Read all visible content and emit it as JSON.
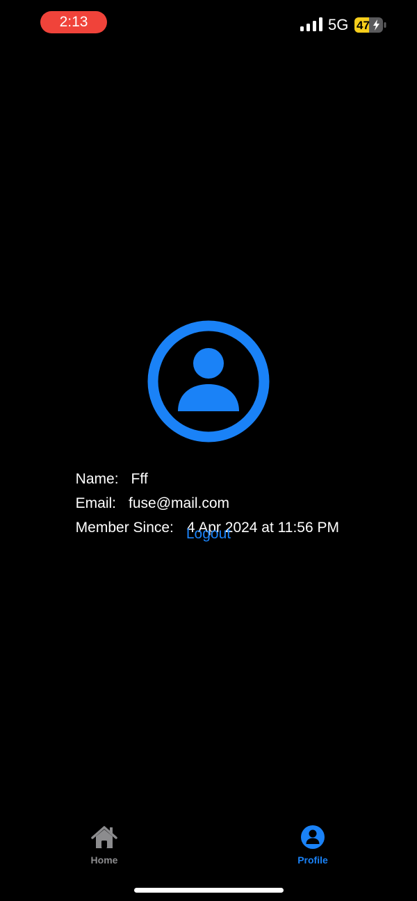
{
  "status_bar": {
    "time": "2:13",
    "network": "5G",
    "battery_level": "47",
    "time_pill_color": "#f0433a",
    "battery_color": "#f7ce1b"
  },
  "icons": {
    "avatar": "person-circle-icon",
    "signal": "cellular-signal-icon",
    "battery": "battery-charging-icon",
    "home_tab": "house-icon",
    "profile_tab": "person-circle-fill-icon"
  },
  "profile": {
    "name_label": "Name:",
    "name_value": "Fff",
    "email_label": "Email:",
    "email_value": "fuse@mail.com",
    "member_since_label": "Member Since:",
    "member_since_value": "4 Apr 2024 at 11:56 PM",
    "logout_label": "Logout"
  },
  "tab_bar": {
    "tabs": [
      {
        "label": "Home",
        "selected": false
      },
      {
        "label": "Profile",
        "selected": true
      }
    ]
  },
  "colors": {
    "accent": "#1a82f7",
    "background": "#000000",
    "inactive_tab": "#8c8c8e"
  }
}
